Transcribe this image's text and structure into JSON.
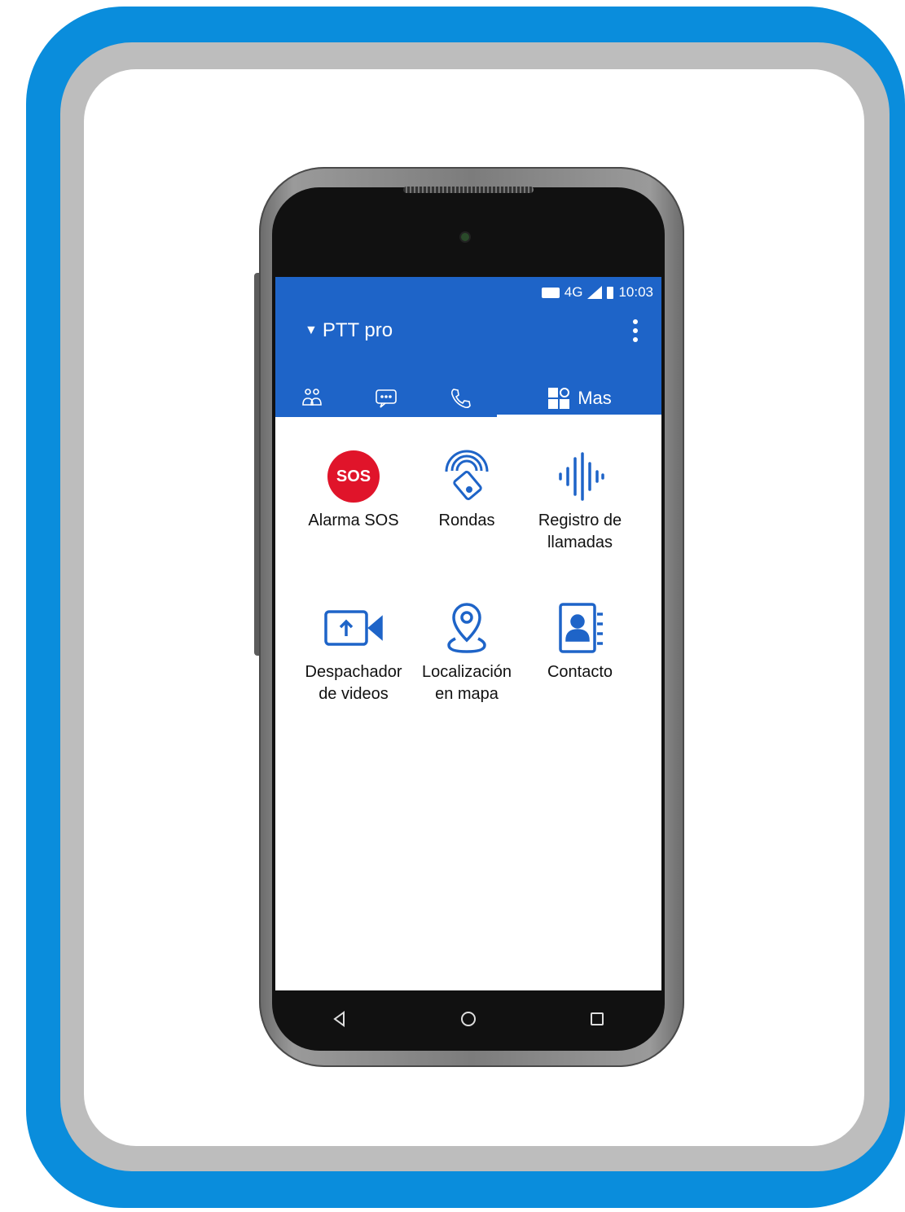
{
  "statusbar": {
    "network": "4G",
    "time": "10:03"
  },
  "appbar": {
    "title": "PTT pro"
  },
  "tabs": [
    {
      "icon": "contacts-icon"
    },
    {
      "icon": "message-icon"
    },
    {
      "icon": "phone-icon"
    },
    {
      "icon": "more-grid-icon",
      "label": "Mas"
    }
  ],
  "items": [
    {
      "label": "Alarma SOS",
      "icon": "sos-icon",
      "icon_text": "SOS"
    },
    {
      "label": "Rondas",
      "icon": "nfc-patrol-icon"
    },
    {
      "label": "Registro de llamadas",
      "icon": "audio-wave-icon"
    },
    {
      "label": "Despachador de videos",
      "icon": "video-upload-icon"
    },
    {
      "label": "Localización en mapa",
      "icon": "map-pin-icon"
    },
    {
      "label": "Contacto",
      "icon": "contact-book-icon"
    }
  ],
  "colors": {
    "frame_blue": "#0a8ddc",
    "appbar": "#1e64c8",
    "sos_red": "#e0142a",
    "icon_blue": "#1e64c8"
  }
}
